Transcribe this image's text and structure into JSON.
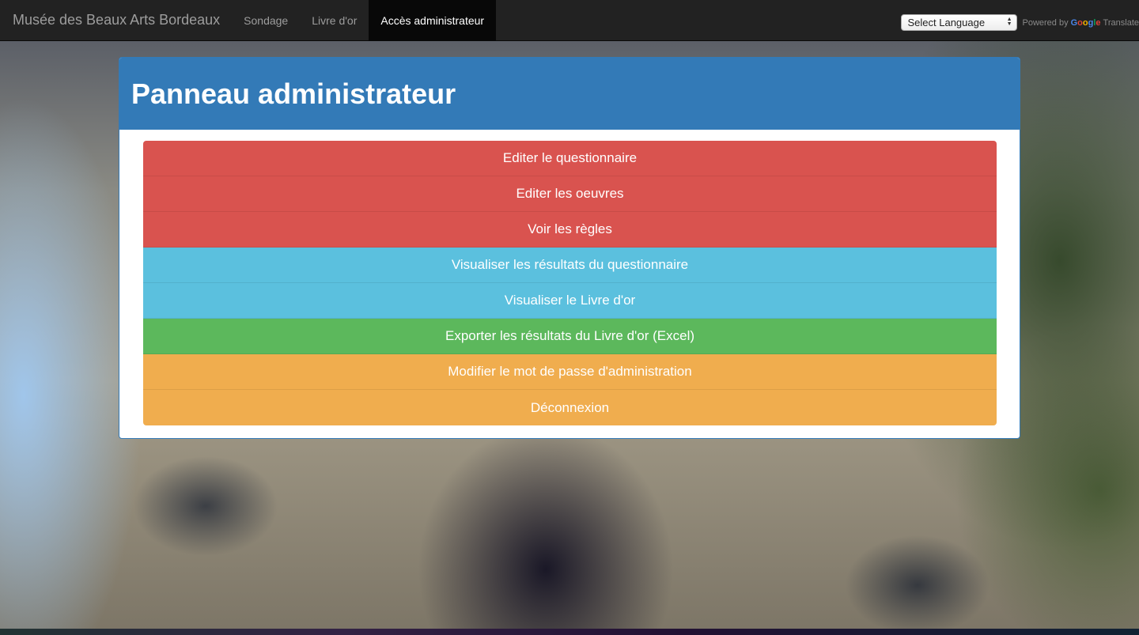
{
  "navbar": {
    "brand": "Musée des Beaux Arts Bordeaux",
    "items": [
      {
        "label": "Sondage"
      },
      {
        "label": "Livre d'or"
      },
      {
        "label": "Accès administrateur"
      }
    ],
    "language_select": "Select Language",
    "powered_by": "Powered by",
    "google_letters": [
      "G",
      "o",
      "o",
      "g",
      "l",
      "e"
    ],
    "translate": "Translate"
  },
  "panel": {
    "title": "Panneau administrateur",
    "buttons": [
      {
        "label": "Editer le questionnaire",
        "style": "danger",
        "color": "#d9534f"
      },
      {
        "label": "Editer les oeuvres",
        "style": "danger",
        "color": "#d9534f"
      },
      {
        "label": "Voir les règles",
        "style": "danger",
        "color": "#d9534f"
      },
      {
        "label": "Visualiser les résultats du questionnaire",
        "style": "info",
        "color": "#5bc0de"
      },
      {
        "label": "Visualiser le Livre d'or",
        "style": "info",
        "color": "#5bc0de"
      },
      {
        "label": "Exporter les résultats du Livre d'or (Excel)",
        "style": "success",
        "color": "#5cb85c"
      },
      {
        "label": "Modifier le mot de passe d'administration",
        "style": "warning",
        "color": "#f0ad4e"
      },
      {
        "label": "Déconnexion",
        "style": "warning",
        "color": "#f0ad4e"
      }
    ]
  },
  "colors": {
    "navbar": "#222222",
    "panel_primary": "#337ab7"
  }
}
